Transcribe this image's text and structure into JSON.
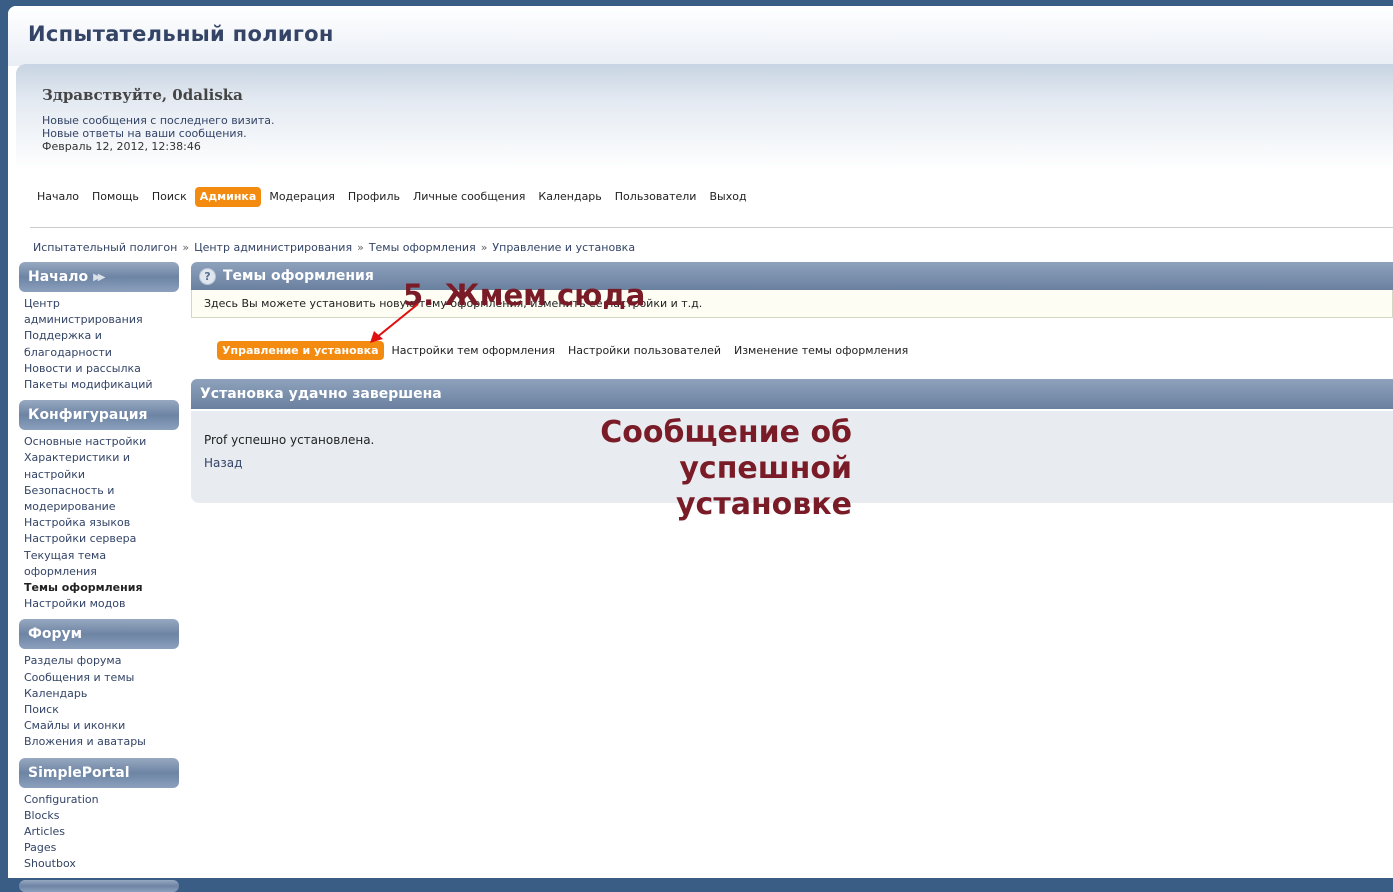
{
  "site": {
    "title": "Испытательный полигон"
  },
  "user": {
    "greeting": "Здравствуйте, 0daliska",
    "new_posts": "Новые сообщения с последнего визита.",
    "new_replies": "Новые ответы на ваши сообщения.",
    "datetime": "Февраль 12, 2012, 12:38:46"
  },
  "menu": [
    "Начало",
    "Помощь",
    "Поиск",
    "Админка",
    "Модерация",
    "Профиль",
    "Личные сообщения",
    "Календарь",
    "Пользователи",
    "Выход"
  ],
  "menu_active": "Админка",
  "breadcrumb": [
    "Испытательный полигон",
    "Центр администрирования",
    "Темы оформления",
    "Управление и установка"
  ],
  "breadcrumb_sep": "»",
  "sidebar": {
    "sections": [
      {
        "title": "Начало",
        "items": [
          "Центр администрирования",
          "Поддержка и благодарности",
          "Новости и рассылка",
          "Пакеты модификаций"
        ]
      },
      {
        "title": "Конфигурация",
        "items": [
          "Основные настройки",
          "Характеристики и настройки",
          "Безопасность и модерирование",
          "Настройка языков",
          "Настройки сервера",
          "Текущая тема оформления",
          "Темы оформления",
          "Настройки модов"
        ]
      },
      {
        "title": "Форум",
        "items": [
          "Разделы форума",
          "Сообщения и темы",
          "Календарь",
          "Поиск",
          "Смайлы и иконки",
          "Вложения и аватары"
        ]
      },
      {
        "title": "SimplePortal",
        "items": [
          "Configuration",
          "Blocks",
          "Articles",
          "Pages",
          "Shoutbox"
        ]
      }
    ],
    "current_item": "Темы оформления"
  },
  "themes": {
    "title": "Темы оформления",
    "help_icon": "?",
    "description": "Здесь Вы можете установить новую тему оформления, изменить её настройки и т.д.",
    "tabs": [
      "Управление и установка",
      "Настройки тем оформления",
      "Настройки пользователей",
      "Изменение темы оформления"
    ],
    "active_tab": "Управление и установка"
  },
  "install": {
    "title": "Установка удачно завершена",
    "message": "Prof успешно установлена.",
    "back": "Назад"
  },
  "annotations": {
    "click_here": "5. Жмем сюда",
    "success_line1": "Сообщение об успешной",
    "success_line2": "установке",
    "color": "#7a1c27",
    "arrow_color": "#e01010"
  }
}
